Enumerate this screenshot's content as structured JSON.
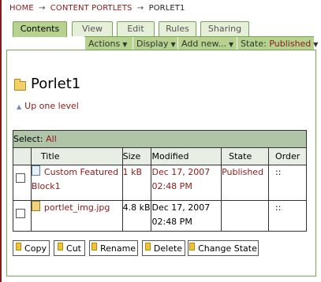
{
  "breadcrumb": {
    "home": "HOME",
    "section": "CONTENT PORTLETS",
    "current": "PORLET1",
    "sep": "→"
  },
  "tabs": {
    "contents": "Contents",
    "view": "View",
    "edit": "Edit",
    "rules": "Rules",
    "sharing": "Sharing"
  },
  "actions": {
    "actions": "Actions",
    "display": "Display",
    "add_new": "Add new...",
    "state_label": "State:",
    "state_value": "Published",
    "arrow": "▼"
  },
  "folder": {
    "title": "Porlet1",
    "up_one_level": "Up one level"
  },
  "table": {
    "select_label": "Select:",
    "select_all": "All",
    "headers": {
      "title": "Title",
      "size": "Size",
      "modified": "Modified",
      "state": "State",
      "order": "Order"
    },
    "rows": [
      {
        "title": "Custom Featured Block1",
        "size": "1 kB",
        "modified_date": "Dec 17, 2007",
        "modified_time": "02:48 PM",
        "state": "Published",
        "order": "::"
      },
      {
        "title": "portlet_img.jpg",
        "size": "4.8 kB",
        "modified_date": "Dec 17, 2007",
        "modified_time": "02:48 PM",
        "state": "",
        "order": "::"
      }
    ]
  },
  "buttons": {
    "copy": "Copy",
    "cut": "Cut",
    "rename": "Rename",
    "delete": "Delete",
    "change_state": "Change State"
  }
}
